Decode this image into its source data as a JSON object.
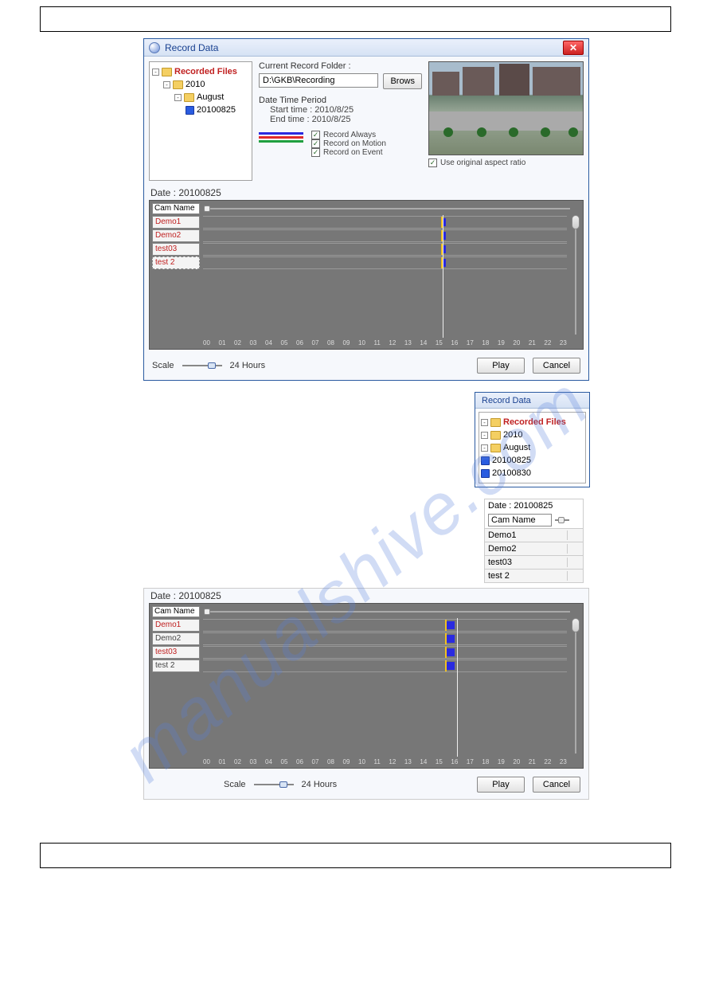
{
  "watermark": "manualshive.com",
  "win1": {
    "title": "Record Data",
    "folder_label": "Current Record Folder :",
    "folder_value": "D:\\GKB\\Recording",
    "browse": "Brows",
    "dtp_title": "Date Time Period",
    "start_label": "Start time : 2010/8/25",
    "end_label": "End time : 2010/8/25",
    "legend_always": "Record Always",
    "legend_motion": "Record on Motion",
    "legend_event": "Record on Event",
    "aspect": "Use original aspect ratio",
    "tree": {
      "root": "Recorded Files",
      "year": "2010",
      "month": "August",
      "day": "20100825"
    },
    "date_label": "Date : 20100825",
    "cam_name_header": "Cam Name",
    "cams": [
      "Demo1",
      "Demo2",
      "test03",
      "test 2"
    ],
    "timelabels": [
      "00",
      "01",
      "02",
      "03",
      "04",
      "05",
      "06",
      "07",
      "08",
      "09",
      "10",
      "11",
      "12",
      "13",
      "14",
      "15",
      "16",
      "17",
      "18",
      "19",
      "20",
      "21",
      "22",
      "23"
    ],
    "scale_label": "Scale",
    "hours_label": "24 Hours",
    "play": "Play",
    "cancel": "Cancel",
    "chart_data": {
      "type": "table",
      "axis": "hours_0_23",
      "playhead_hour": 15.8,
      "rows": [
        {
          "cam": "Demo1",
          "markers": [
            {
              "hour": 15.8,
              "type": "motion"
            }
          ]
        },
        {
          "cam": "Demo2",
          "markers": [
            {
              "hour": 15.8,
              "type": "motion"
            }
          ]
        },
        {
          "cam": "test03",
          "markers": [
            {
              "hour": 15.8,
              "type": "motion"
            }
          ]
        },
        {
          "cam": "test 2",
          "markers": [
            {
              "hour": 15.8,
              "type": "motion"
            }
          ]
        }
      ]
    }
  },
  "small_tree": {
    "title": "Record Data",
    "root": "Recorded Files",
    "year": "2010",
    "month": "August",
    "days": [
      "20100825",
      "20100830"
    ],
    "selected": "20100825"
  },
  "small_cam": {
    "date_label": "Date : 20100825",
    "header": "Cam Name",
    "cams": [
      "Demo1",
      "Demo2",
      "test03",
      "test 2"
    ]
  },
  "lower": {
    "date_label": "Date : 20100825",
    "cam_name_header": "Cam Name",
    "cams": [
      {
        "name": "Demo1",
        "style": "red"
      },
      {
        "name": "Demo2",
        "style": "gray"
      },
      {
        "name": "test03",
        "style": "red"
      },
      {
        "name": "test 2",
        "style": "gray"
      }
    ],
    "timelabels": [
      "00",
      "01",
      "02",
      "03",
      "04",
      "05",
      "06",
      "07",
      "08",
      "09",
      "10",
      "11",
      "12",
      "13",
      "14",
      "15",
      "16",
      "17",
      "18",
      "19",
      "20",
      "21",
      "22",
      "23"
    ],
    "scale_label": "Scale",
    "hours_label": "24 Hours",
    "play": "Play",
    "cancel": "Cancel",
    "chart_data": {
      "type": "table",
      "axis": "hours_0_23",
      "playhead_hour": 16.7,
      "rows": [
        {
          "cam": "Demo1",
          "markers": [
            {
              "hour": 16.0,
              "len": 0.4,
              "type": "always"
            },
            {
              "hour": 16.5,
              "type": "motion"
            }
          ]
        },
        {
          "cam": "Demo2",
          "markers": [
            {
              "hour": 16.0,
              "len": 0.4,
              "type": "always"
            },
            {
              "hour": 16.5,
              "type": "motion"
            }
          ]
        },
        {
          "cam": "test03",
          "markers": [
            {
              "hour": 16.0,
              "len": 0.4,
              "type": "always"
            },
            {
              "hour": 16.5,
              "type": "motion"
            }
          ]
        },
        {
          "cam": "test 2",
          "markers": [
            {
              "hour": 16.0,
              "len": 0.4,
              "type": "always"
            },
            {
              "hour": 16.5,
              "type": "motion"
            }
          ]
        }
      ]
    }
  }
}
